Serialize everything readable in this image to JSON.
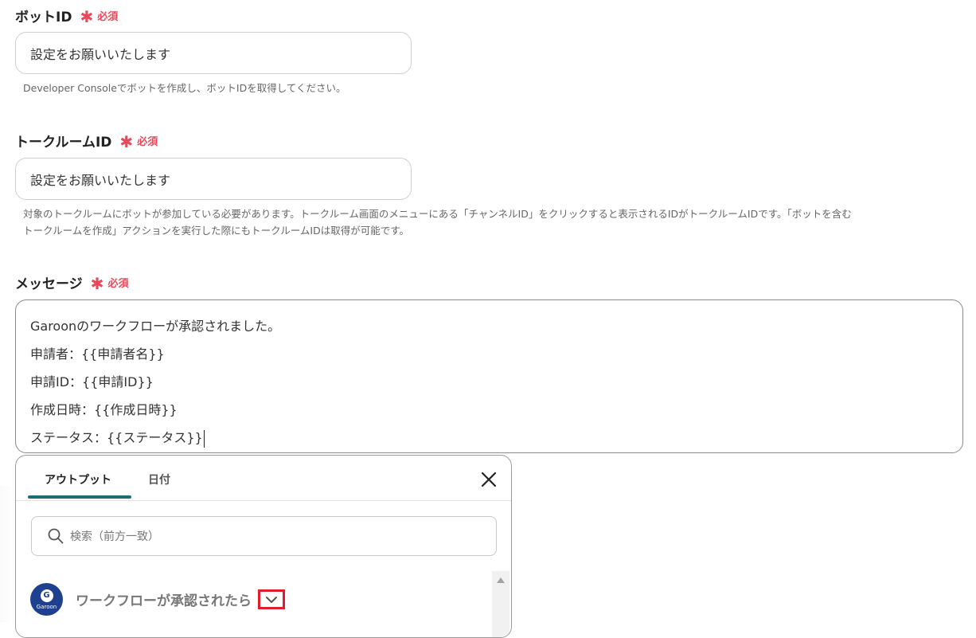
{
  "required_label": "必須",
  "fields": {
    "bot_id": {
      "label": "ボットID",
      "placeholder": "設定をお願いいたします",
      "help": "Developer Consoleでボットを作成し、ボットIDを取得してください。"
    },
    "talkroom_id": {
      "label": "トークルームID",
      "placeholder": "設定をお願いいたします",
      "help_line1": "対象のトークルームにボットが参加している必要があります。トークルーム画面のメニューにある「チャンネルID」をクリックすると表示されるIDがトークルームIDです。「ボットを含む",
      "help_line2": "トークルームを作成」アクションを実行した際にもトークルームIDは取得が可能です。"
    },
    "message": {
      "label": "メッセージ",
      "lines": [
        "Garoonのワークフローが承認されました。",
        "申請者：{{申請者名}}",
        "申請ID：{{申請ID}}",
        "作成日時：{{作成日時}}",
        "ステータス：{{ステータス}}"
      ]
    }
  },
  "popup": {
    "tabs": [
      "アウトプット",
      "日付"
    ],
    "active_tab": 0,
    "search_placeholder": "検索（前方一致）",
    "app": {
      "logo_letter": "G",
      "logo_text": "Garoon",
      "name": "ワークフローが承認されたら"
    }
  },
  "colors": {
    "required": "#e8485a",
    "tab_underline": "#1c6f78",
    "highlight_box": "#e01e2b",
    "garoon_logo": "#1f3f8f"
  }
}
